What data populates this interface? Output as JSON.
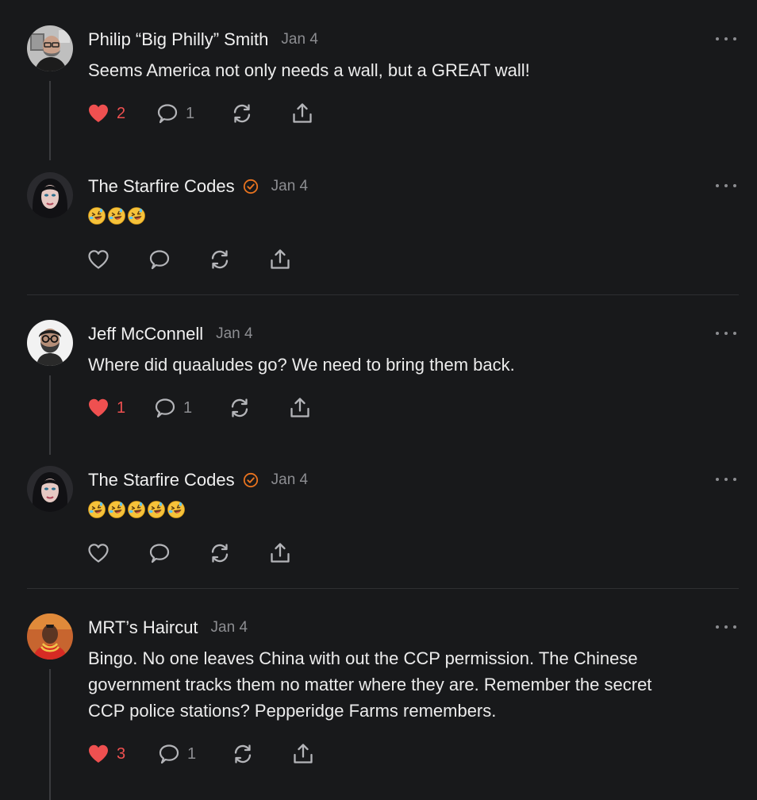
{
  "comments": [
    {
      "author": "Philip “Big Philly” Smith",
      "verified": false,
      "date": "Jan 4",
      "text": "Seems America not only needs a wall, but a GREAT wall!",
      "likes": "2",
      "replies": "1",
      "liked": true
    },
    {
      "author": "The Starfire Codes",
      "verified": true,
      "date": "Jan 4",
      "emoji_count": 3,
      "emoji_name": "rolling-on-floor-laughing",
      "liked": false
    },
    {
      "author": "Jeff McConnell",
      "verified": false,
      "date": "Jan 4",
      "text": "Where did quaaludes go? We need to bring them back.",
      "likes": "1",
      "replies": "1",
      "liked": true
    },
    {
      "author": "The Starfire Codes",
      "verified": true,
      "date": "Jan 4",
      "emoji_count": 5,
      "emoji_name": "rolling-on-floor-laughing",
      "liked": false
    },
    {
      "author": "MRT’s Haircut",
      "verified": false,
      "date": "Jan 4",
      "text_lines": [
        "Bingo. No one leaves China with out the CCP permission. The Chinese",
        "government tracks them no matter where they are. Remember the secret",
        "CCP police stations? Pepperidge Farms remembers."
      ],
      "likes": "3",
      "replies": "1",
      "liked": true
    }
  ],
  "colors": {
    "background": "#18191b",
    "like_active": "#ef5050",
    "verified_badge": "#e8731f",
    "muted": "#8c8d91"
  },
  "icons": [
    "heart-icon",
    "comment-icon",
    "restack-icon",
    "share-icon",
    "more-options-icon",
    "verified-badge-icon"
  ]
}
